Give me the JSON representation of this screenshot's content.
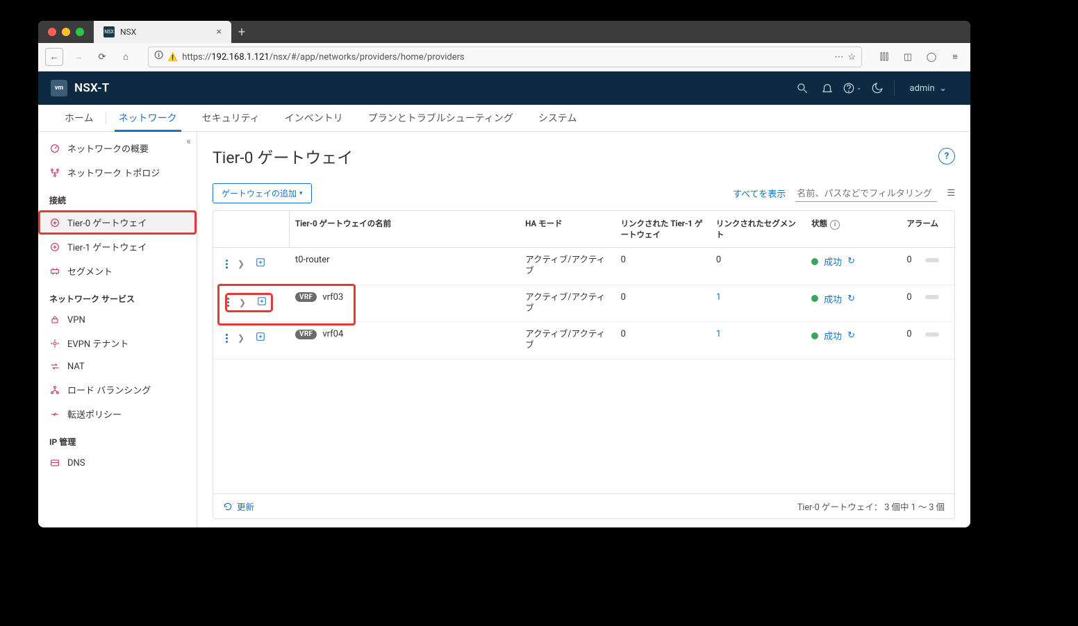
{
  "browser": {
    "tab_title": "NSX",
    "url_before": "https://",
    "url_host": "192.168.1.121",
    "url_path": "/nsx/#/app/networks/providers/home/providers"
  },
  "header": {
    "app_title": "NSX-T",
    "user": "admin"
  },
  "toptabs": {
    "home": "ホーム",
    "network": "ネットワーク",
    "security": "セキュリティ",
    "inventory": "インベントリ",
    "plan": "プランとトラブルシューティング",
    "system": "システム"
  },
  "sidebar": {
    "overview": "ネットワークの概要",
    "topology": "ネットワーク トポロジ",
    "sec_connect": "接続",
    "tier0": "Tier-0 ゲートウェイ",
    "tier1": "Tier-1 ゲートウェイ",
    "segment": "セグメント",
    "sec_services": "ネットワーク サービス",
    "vpn": "VPN",
    "evpn": "EVPN テナント",
    "nat": "NAT",
    "lb": "ロード バランシング",
    "fwd": "転送ポリシー",
    "sec_ip": "IP 管理",
    "dns": "DNS"
  },
  "page": {
    "title": "Tier-0 ゲートウェイ",
    "add_btn": "ゲートウェイの追加",
    "show_all": "すべてを表示",
    "filter_ph": "名前、パスなどでフィルタリング",
    "refresh": "更新",
    "footer_count": "Tier-0 ゲートウェイ：  3 個中 1 ～ 3 個"
  },
  "columns": {
    "name": "Tier-0 ゲートウェイの名前",
    "ha": "HA モード",
    "t1": "リンクされた Tier-1 ゲートウェイ",
    "seg": "リンクされたセグメント",
    "status": "状態",
    "alarm": "アラーム"
  },
  "rows": [
    {
      "name": "t0-router",
      "vrf": false,
      "ha": "アクティブ/アクティブ",
      "t1": "0",
      "t1_link": false,
      "seg": "0",
      "seg_link": false,
      "status": "成功",
      "alarm": "0",
      "hl": false
    },
    {
      "name": "vrf03",
      "vrf": true,
      "ha": "アクティブ/アクティブ",
      "t1": "0",
      "t1_link": false,
      "seg": "1",
      "seg_link": true,
      "status": "成功",
      "alarm": "0",
      "hl": true
    },
    {
      "name": "vrf04",
      "vrf": true,
      "ha": "アクティブ/アクティブ",
      "t1": "0",
      "t1_link": false,
      "seg": "1",
      "seg_link": true,
      "status": "成功",
      "alarm": "0",
      "hl": false
    }
  ],
  "misc": {
    "vrf_badge": "VRF"
  }
}
